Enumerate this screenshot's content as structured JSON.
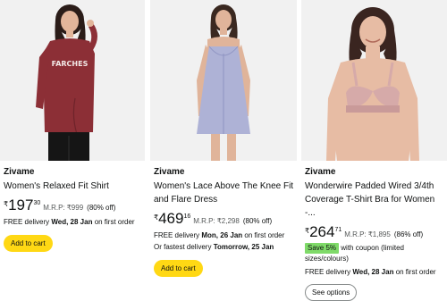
{
  "products": [
    {
      "brand": "Zivame",
      "title": "Women's Relaxed Fit Shirt",
      "currency": "₹",
      "price_whole": "197",
      "price_fraction": "30",
      "mrp_label": "M.R.P:",
      "mrp_value": "₹999",
      "discount": "(80% off)",
      "delivery_prefix": "FREE delivery",
      "delivery_date": "Wed, 28 Jan",
      "delivery_suffix": "on first order",
      "button_label": "Add to cart",
      "shirt_text": "FARCHES"
    },
    {
      "brand": "Zivame",
      "title": "Women's Lace Above The Knee Fit and Flare Dress",
      "currency": "₹",
      "price_whole": "469",
      "price_fraction": "16",
      "mrp_label": "M.R.P:",
      "mrp_value": "₹2,298",
      "discount": "(80% off)",
      "delivery_prefix": "FREE delivery",
      "delivery_date": "Mon, 26 Jan",
      "delivery_suffix": "on first order",
      "fastest_prefix": "Or fastest delivery",
      "fastest_date": "Tomorrow, 25 Jan",
      "button_label": "Add to cart"
    },
    {
      "brand": "Zivame",
      "title": "Wonderwire Padded Wired 3/4th Coverage T-Shirt Bra for Women -...",
      "currency": "₹",
      "price_whole": "264",
      "price_fraction": "71",
      "mrp_label": "M.R.P:",
      "mrp_value": "₹1,895",
      "discount": "(86% off)",
      "save_badge": "Save 5%",
      "coupon_text": "with coupon (limited sizes/colours)",
      "delivery_prefix": "FREE delivery",
      "delivery_date": "Wed, 28 Jan",
      "delivery_suffix": "on first order",
      "button_label": "See options"
    }
  ],
  "colors": {
    "add_to_cart": "#ffd814",
    "save_badge": "#7fda69",
    "shirt": "#8c2f36",
    "dress": "#aeb2d6",
    "bra": "#d6aaa9"
  }
}
